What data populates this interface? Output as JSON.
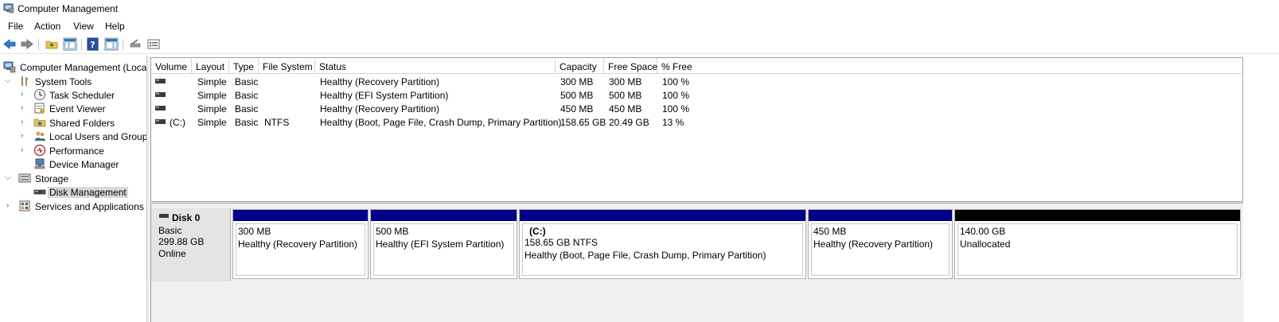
{
  "window": {
    "title": "Computer Management"
  },
  "menu": [
    "File",
    "Action",
    "View",
    "Help"
  ],
  "tree": {
    "root": "Computer Management (Local",
    "items": [
      {
        "label": "System Tools",
        "level": 1,
        "expanded": true,
        "icon": "tools-icon"
      },
      {
        "label": "Task Scheduler",
        "level": 2,
        "icon": "clock-icon"
      },
      {
        "label": "Event Viewer",
        "level": 2,
        "icon": "event-viewer-icon"
      },
      {
        "label": "Shared Folders",
        "level": 2,
        "icon": "shared-folder-icon"
      },
      {
        "label": "Local Users and Groups",
        "level": 2,
        "icon": "users-icon"
      },
      {
        "label": "Performance",
        "level": 2,
        "icon": "performance-icon"
      },
      {
        "label": "Device Manager",
        "level": 2,
        "icon": "device-manager-icon"
      },
      {
        "label": "Storage",
        "level": 1,
        "expanded": true,
        "icon": "storage-icon"
      },
      {
        "label": "Disk Management",
        "level": 2,
        "icon": "disk-icon",
        "selected": true
      },
      {
        "label": "Services and Applications",
        "level": 1,
        "icon": "services-icon"
      }
    ]
  },
  "volume_list": {
    "columns": [
      "Volume",
      "Layout",
      "Type",
      "File System",
      "Status",
      "Capacity",
      "Free Space",
      "% Free"
    ],
    "rows": [
      {
        "volume": "",
        "layout": "Simple",
        "type": "Basic",
        "fs": "",
        "status": "Healthy (Recovery Partition)",
        "capacity": "300 MB",
        "free": "300 MB",
        "pct": "100 %"
      },
      {
        "volume": "",
        "layout": "Simple",
        "type": "Basic",
        "fs": "",
        "status": "Healthy (EFI System Partition)",
        "capacity": "500 MB",
        "free": "500 MB",
        "pct": "100 %"
      },
      {
        "volume": "",
        "layout": "Simple",
        "type": "Basic",
        "fs": "",
        "status": "Healthy (Recovery Partition)",
        "capacity": "450 MB",
        "free": "450 MB",
        "pct": "100 %"
      },
      {
        "volume": "(C:)",
        "layout": "Simple",
        "type": "Basic",
        "fs": "NTFS",
        "status": "Healthy (Boot, Page File, Crash Dump, Primary Partition)",
        "capacity": "158.65 GB",
        "free": "20.49 GB",
        "pct": "13 %"
      }
    ]
  },
  "disk": {
    "name": "Disk 0",
    "type": "Basic",
    "size": "299.88 GB",
    "state": "Online",
    "partitions": [
      {
        "size": "300 MB",
        "status": "Healthy (Recovery Partition)"
      },
      {
        "size": "500 MB",
        "status": "Healthy (EFI System Partition)"
      },
      {
        "name": "(C:)",
        "size": "158.65 GB NTFS",
        "status": "Healthy (Boot, Page File, Crash Dump, Primary Partition)"
      },
      {
        "size": "450 MB",
        "status": "Healthy (Recovery Partition)"
      },
      {
        "size": "140.00 GB",
        "status": "Unallocated"
      }
    ]
  },
  "colors": {
    "primary_bar": "#00008b",
    "unallocated_bar": "#000000"
  }
}
